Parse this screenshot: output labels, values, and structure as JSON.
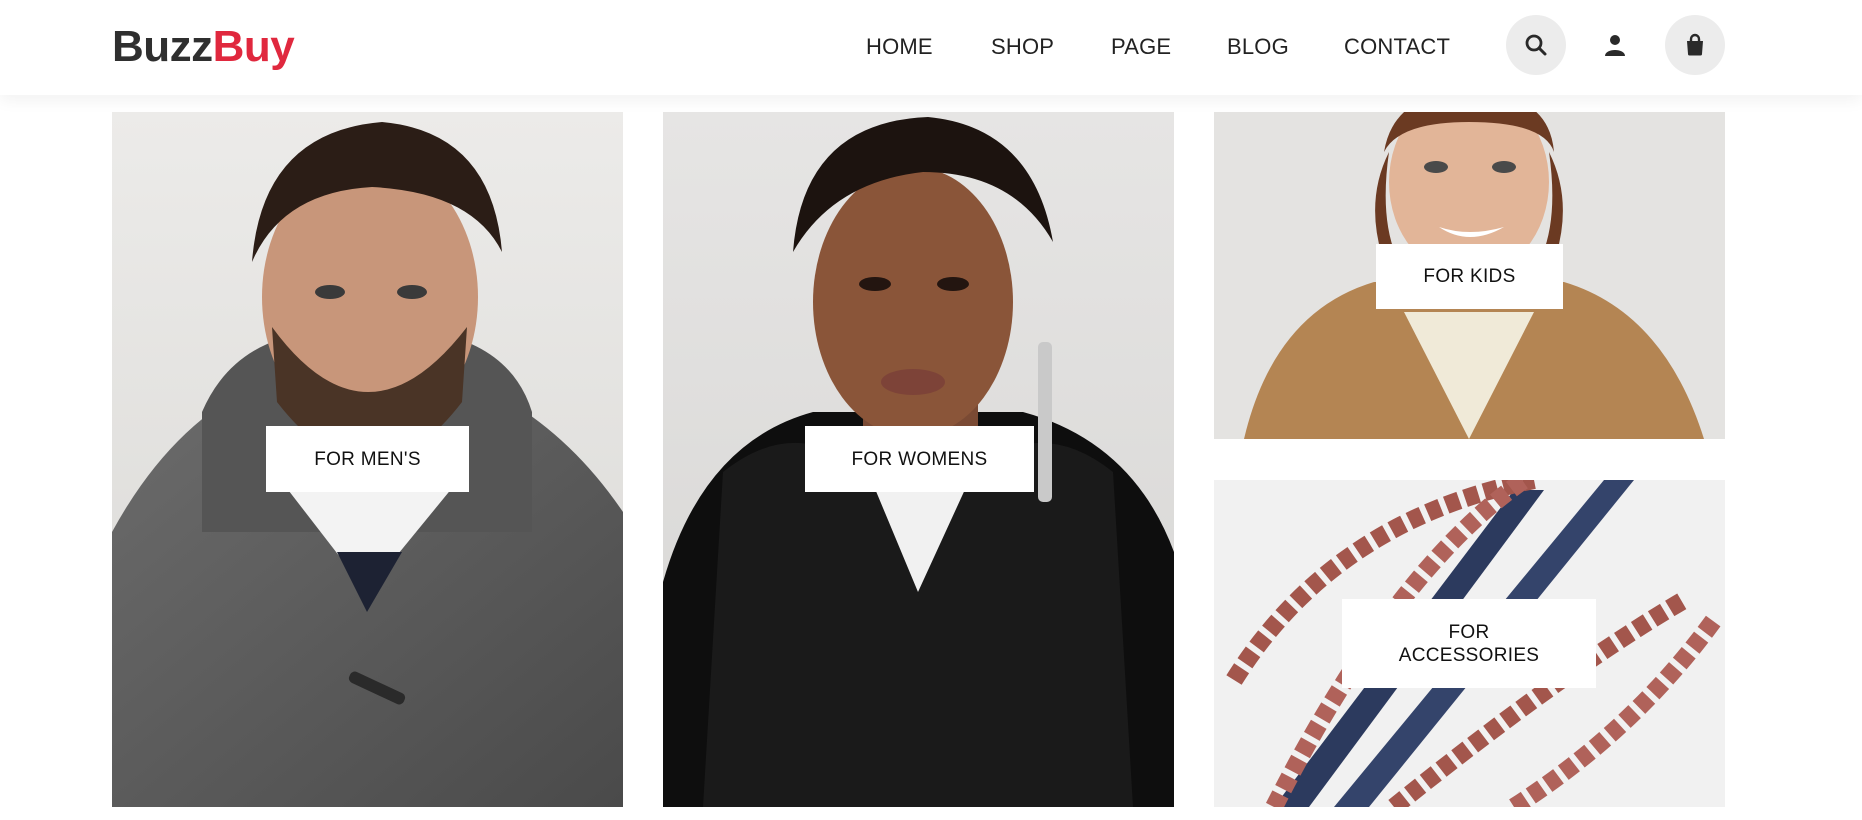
{
  "brand": {
    "part1": "Buzz",
    "part2": "Buy"
  },
  "nav": [
    {
      "label": "HOME"
    },
    {
      "label": "SHOP"
    },
    {
      "label": "PAGE"
    },
    {
      "label": "BLOG"
    },
    {
      "label": "CONTACT"
    }
  ],
  "icons": [
    "search-icon",
    "user-icon",
    "shopping-bag-icon"
  ],
  "categories": {
    "mens": {
      "label": "FOR MEN'S"
    },
    "womens": {
      "label": "FOR WOMENS"
    },
    "kids": {
      "label": "FOR KIDS"
    },
    "accessories": {
      "line1": "FOR",
      "line2": "ACCESSORIES"
    }
  },
  "colors": {
    "brand_dark": "#2f2f2f",
    "brand_accent": "#e0283e",
    "icon_bg": "#ececec"
  }
}
